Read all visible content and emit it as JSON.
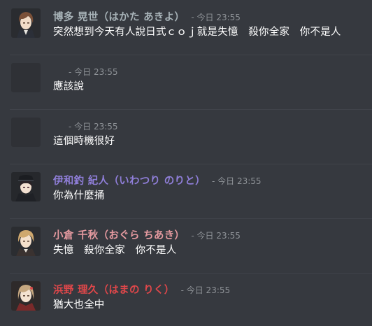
{
  "colors": {
    "background": "#36393f",
    "timestamp": "#8e9297",
    "message_text": "#ffffff"
  },
  "messages": [
    {
      "author": "博多 晃世（はかた あきよ）",
      "author_color": "#a7b2b7",
      "timestamp": "- 今日 23:55",
      "text": "突然想到今天有人說日式ｃｏｊ就是失憶　殺你全家　你不是人",
      "avatar": "avatar-brown-hair-suit"
    },
    {
      "author": "",
      "author_color": "#ffffff",
      "timestamp": "- 今日 23:55",
      "text": "應該說",
      "avatar": "avatar-blank"
    },
    {
      "author": "",
      "author_color": "#ffffff",
      "timestamp": "- 今日 23:55",
      "text": "這個時機很好",
      "avatar": "avatar-blank"
    },
    {
      "author": "伊和釣 紀人（いわつり のりと）",
      "author_color": "#8f7ed8",
      "timestamp": "- 今日 23:55",
      "text": "你為什麼捅",
      "avatar": "avatar-dark-hair-cap"
    },
    {
      "author": "小倉 千秋（おぐら ちあき）",
      "author_color": "#e59aa0",
      "timestamp": "- 今日 23:55",
      "text": "失憶　殺你全家　你不是人",
      "avatar": "avatar-blond-hair"
    },
    {
      "author": "浜野 理久（はまの りく）",
      "author_color": "#e0474a",
      "timestamp": "- 今日 23:55",
      "text": "猶大也全中",
      "avatar": "avatar-light-hair-red"
    }
  ]
}
